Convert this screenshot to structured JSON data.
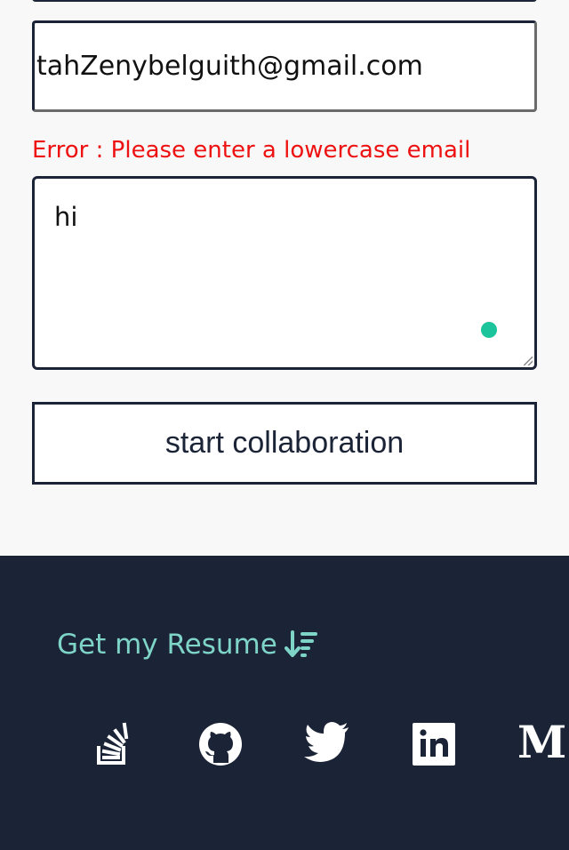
{
  "form": {
    "email_value": "tahZenybelguith@gmail.com",
    "error_message": "Error : Please enter a lowercase email",
    "message_value": "hi",
    "submit_label": "start collaboration"
  },
  "footer": {
    "resume_label": "Get my Resume",
    "resume_icon": "sort-amount-down-icon",
    "social_icons": [
      "stackoverflow-icon",
      "github-icon",
      "twitter-icon",
      "linkedin-icon",
      "medium-icon"
    ],
    "medium_glyph": "M"
  },
  "colors": {
    "error": "#ee1111",
    "footer_bg": "#1b2336",
    "accent": "#7fd4c8",
    "status_dot": "#1bc49a"
  }
}
